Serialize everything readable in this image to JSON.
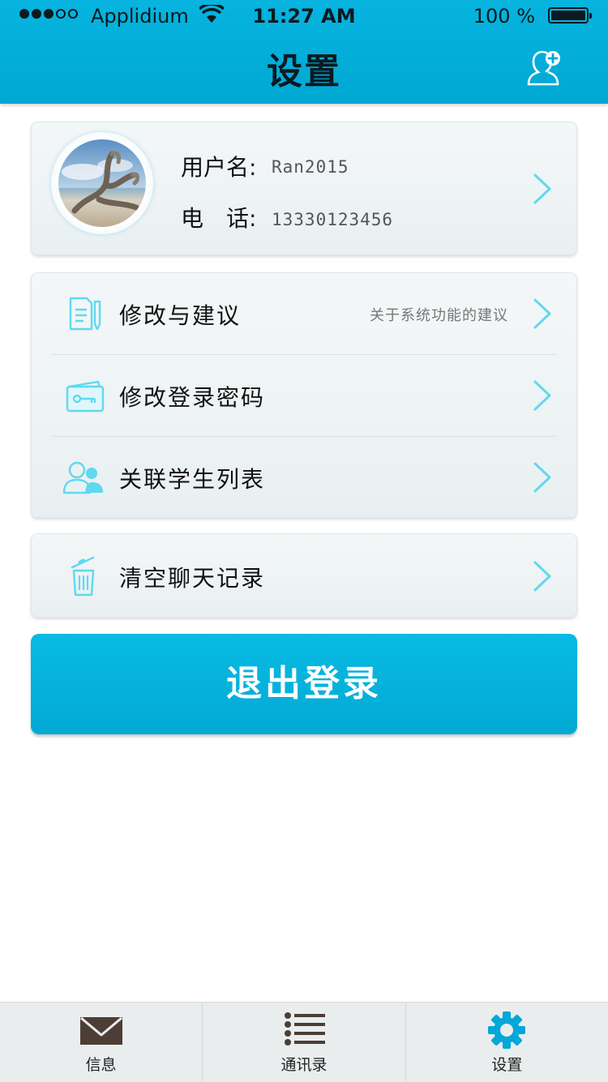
{
  "status_bar": {
    "carrier": "Applidium",
    "time": "11:27 AM",
    "battery": "100 %"
  },
  "header": {
    "title": "设置",
    "add_contact_icon": "add-contact-icon"
  },
  "profile": {
    "username_label": "用户名:",
    "username": "Ran2015",
    "phone_label": "电　话:",
    "phone": "13330123456"
  },
  "menu": {
    "items": [
      {
        "label": "修改与建议",
        "hint": "关于系统功能的建议",
        "icon": "document-edit-icon"
      },
      {
        "label": "修改登录密码",
        "hint": "",
        "icon": "key-card-icon"
      },
      {
        "label": "关联学生列表",
        "hint": "",
        "icon": "users-icon"
      }
    ]
  },
  "clear_history": {
    "label": "清空聊天记录",
    "icon": "trash-icon"
  },
  "logout": {
    "label": "退出登录"
  },
  "tabs": [
    {
      "label": "信息",
      "icon": "mail-icon"
    },
    {
      "label": "通讯录",
      "icon": "list-icon"
    },
    {
      "label": "设置",
      "icon": "gear-icon",
      "active": true
    }
  ],
  "colors": {
    "brand": "#04aed9",
    "icon_outline": "#5fd9ef",
    "active_tab": "#03a7d8",
    "inactive_tab_icon": "#4d3e35"
  }
}
